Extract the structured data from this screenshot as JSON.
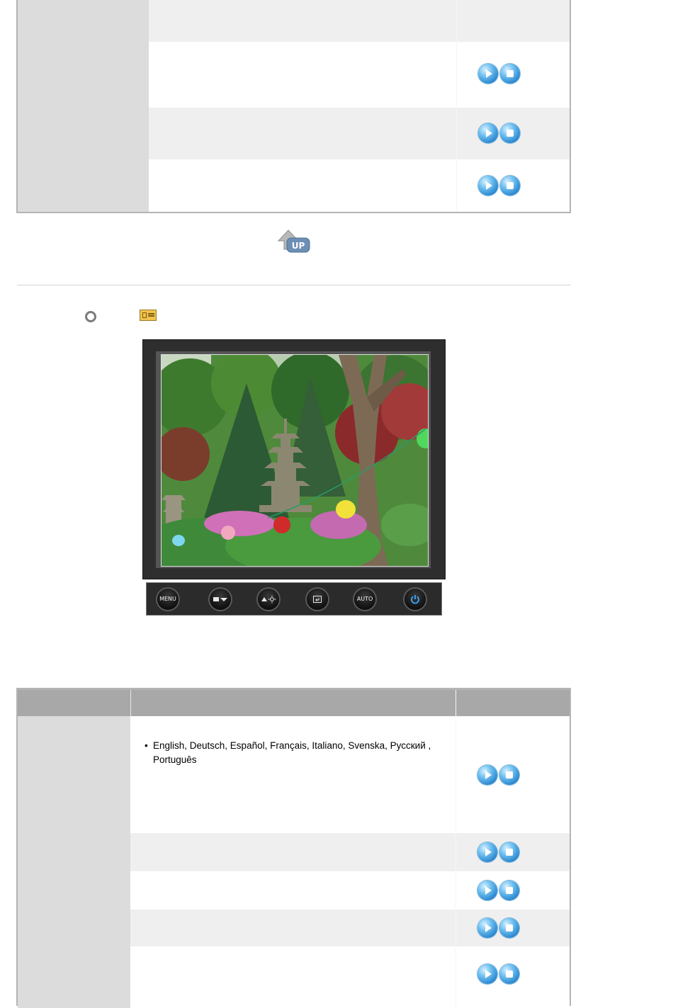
{
  "languages_text": "English, Deutsch, Español, Français,  Italiano, Svenska, Pусский , Português",
  "bullet": "•",
  "control_buttons": {
    "menu": "MENU",
    "auto": "AUTO"
  },
  "icons": {
    "play": "play-icon",
    "stop": "stop-icon",
    "up": "up-arrow-icon",
    "power": "power-icon"
  },
  "colors": {
    "label_cell": "#dcdcdc",
    "shaded_row": "#efefef",
    "header_row": "#a8a8a8",
    "bubble_blue": "#2a86cf"
  }
}
